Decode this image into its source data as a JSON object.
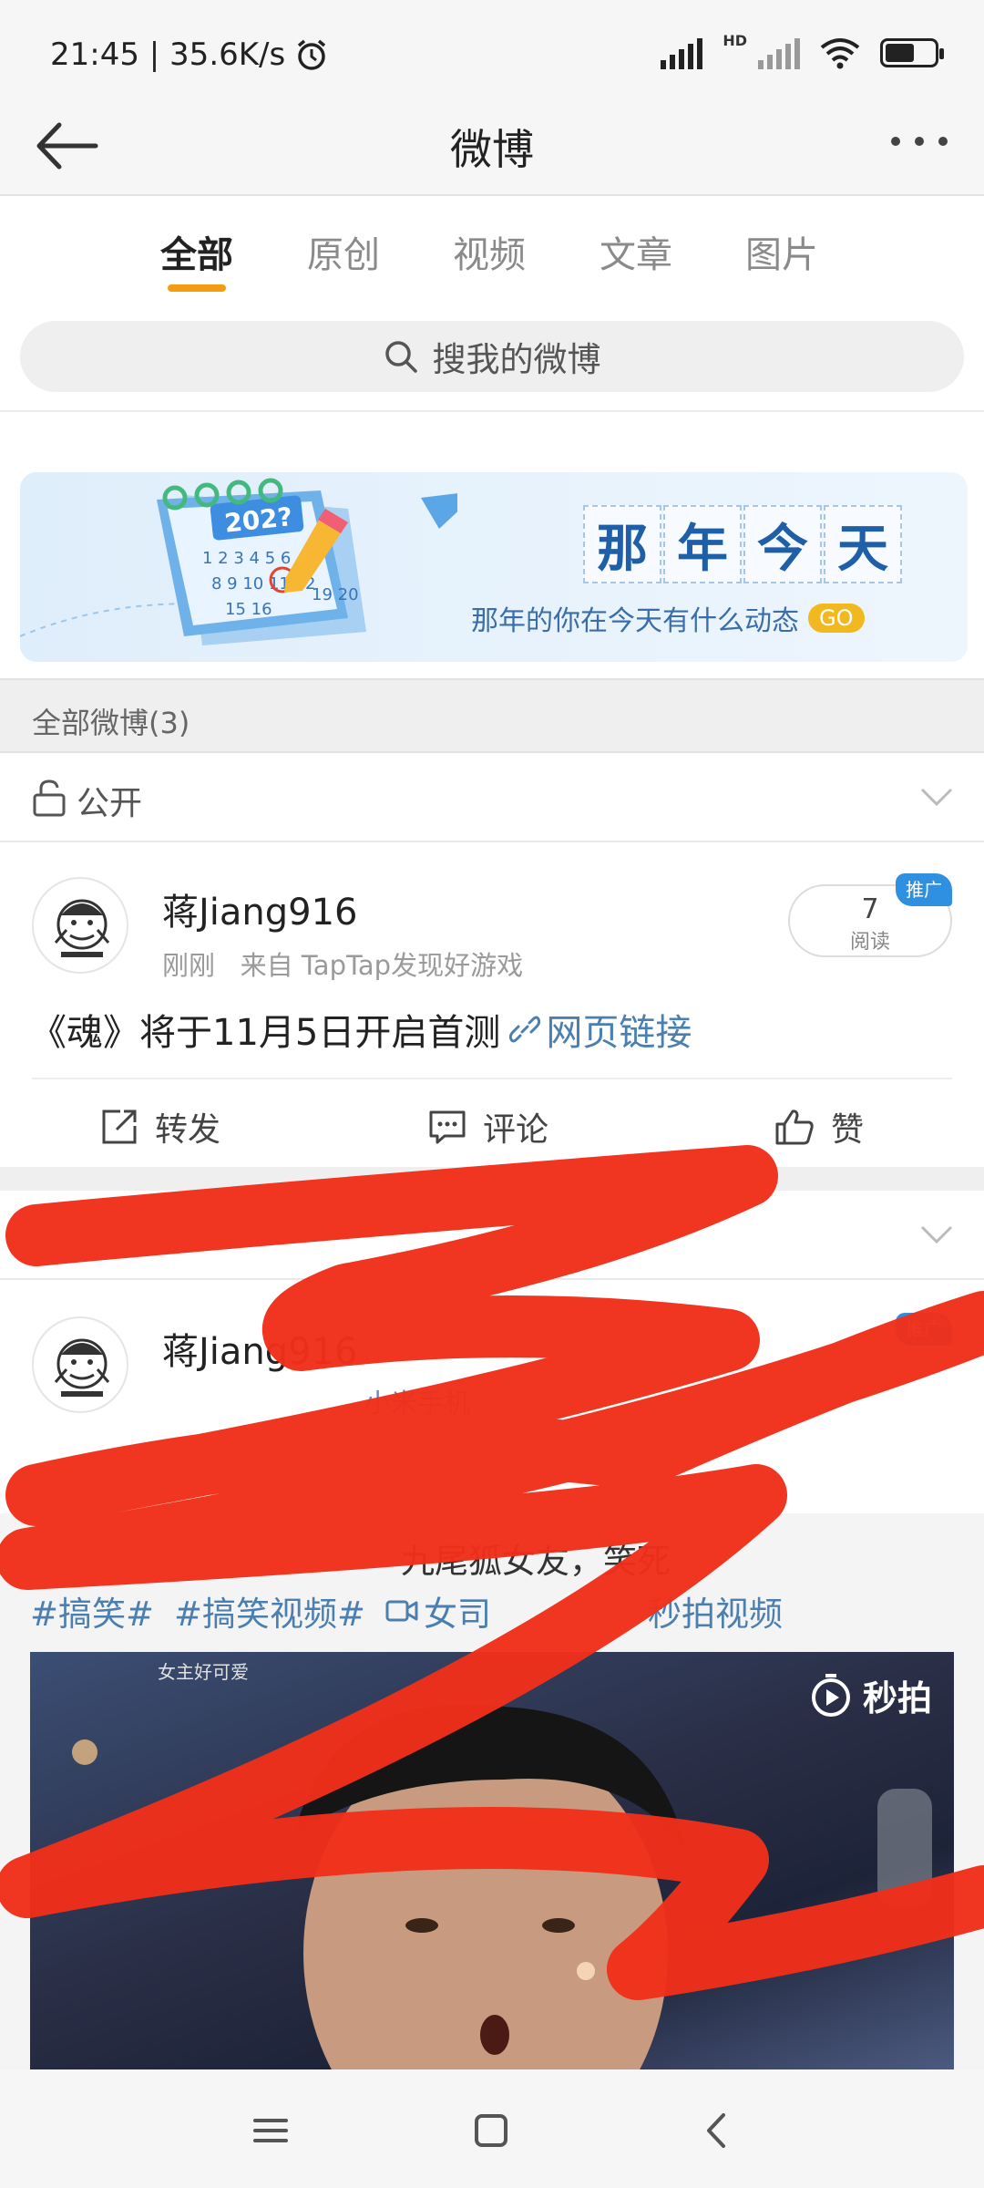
{
  "status_bar": {
    "time_speed": "21:45 | 35.6K/s",
    "network_badge": "HD",
    "battery_level": 0.6
  },
  "title_bar": {
    "title": "微博"
  },
  "tabs": [
    {
      "label": "全部",
      "active": true
    },
    {
      "label": "原创",
      "active": false
    },
    {
      "label": "视频",
      "active": false
    },
    {
      "label": "文章",
      "active": false
    },
    {
      "label": "图片",
      "active": false
    }
  ],
  "search": {
    "placeholder": "搜我的微博"
  },
  "banner": {
    "calendar_year": "202?",
    "headline": [
      "那",
      "年",
      "今",
      "天"
    ],
    "subtitle": "那年的你在今天有什么动态",
    "go_label": "GO"
  },
  "section_header": {
    "label": "全部微博(3)"
  },
  "posts": [
    {
      "visibility": "公开",
      "author": "蒋Jiang916",
      "time": "刚刚",
      "source": "来自 TapTap发现好游戏",
      "reads": "7",
      "reads_label": "阅读",
      "promo": "推广",
      "text": "《魂》将于11月5日开启首测",
      "link_label": "网页链接",
      "actions": {
        "repost": "转发",
        "comment": "评论",
        "like": "赞"
      }
    },
    {
      "author": "蒋Jiang916",
      "source_fragment": "小米手机",
      "promo": "推广",
      "repost_text": "九尾狐女友，笑死",
      "tags": [
        "#搞笑#",
        "#搞笑视频#",
        "女司",
        "秒拍视频"
      ],
      "video_caption": "女主好可爱",
      "video_brand": "秒拍"
    }
  ],
  "colors": {
    "accent_orange": "#f39c12",
    "link_blue": "#4a7fb0",
    "scribble_red": "#f0301a"
  }
}
